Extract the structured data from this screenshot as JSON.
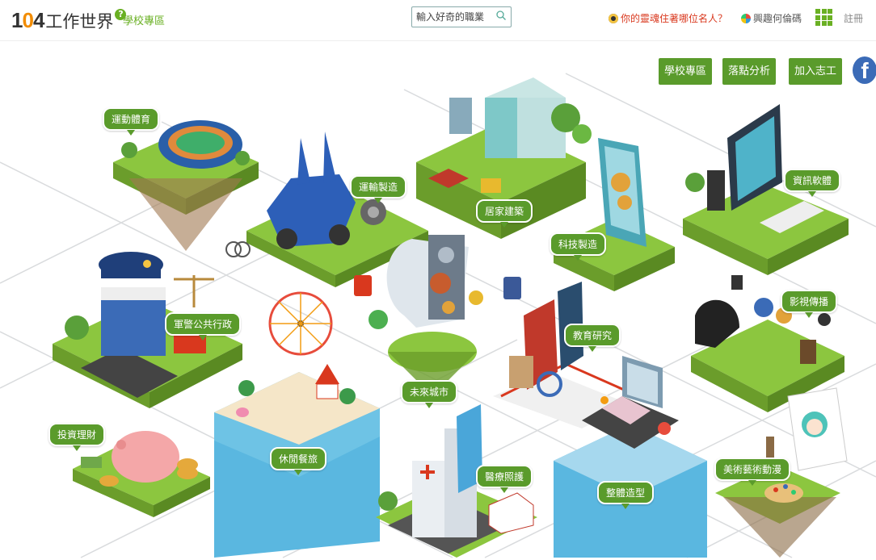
{
  "header": {
    "logo_number": "104",
    "logo_text": "工作世界",
    "logo_badge": "?",
    "school_link": "學校專區",
    "search_placeholder": "輸入好奇的職業",
    "quiz_link": "你的靈魂住著哪位名人？",
    "interest_link": "興趣何倫碼",
    "register_label": "註冊",
    "colors": {
      "brand_green": "#6ab023",
      "logo_orange": "#f28c00",
      "quiz_red": "#d9381e"
    }
  },
  "top_buttons": [
    "學校專區",
    "落點分析",
    "加入志工"
  ],
  "facebook_icon": "f",
  "islands": [
    "運動體育",
    "運輸製造",
    "居家建築",
    "科技製造",
    "資訊軟體",
    "軍警公共行政",
    "未來城市",
    "教育研究",
    "影視傳播",
    "投資理財",
    "休閒餐旅",
    "醫療照護",
    "整體造型",
    "美術藝術動漫"
  ]
}
